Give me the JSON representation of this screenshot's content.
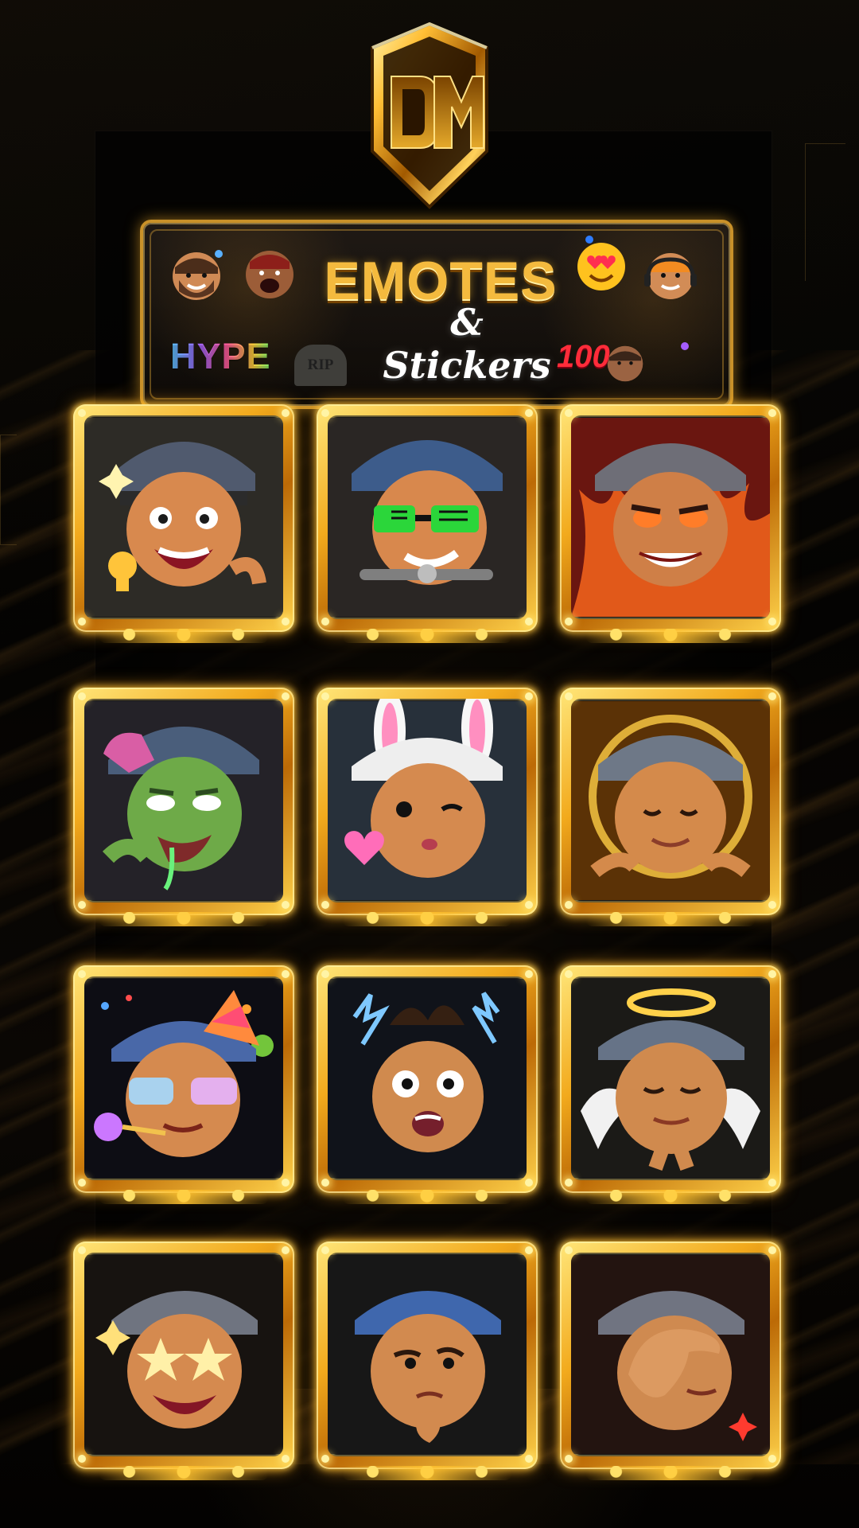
{
  "brand": {
    "logo_text": "DM",
    "accent_gold": "#f0b43a",
    "accent_orange": "#ff9c2a",
    "dark_bg": "#050403"
  },
  "banner": {
    "title": "EMOTES",
    "subtitle": "& Stickers",
    "hype": "HYPE",
    "rip": "RIP",
    "hundred": "100"
  },
  "emotes": [
    {
      "icon": "trophy-emote-icon",
      "bg": "#2d2b26"
    },
    {
      "icon": "driving-sunglasses-emote-icon",
      "bg": "#2a2624"
    },
    {
      "icon": "rage-emote-icon",
      "bg": "#6a1610"
    },
    {
      "icon": "zombie-emote-icon",
      "bg": "#242228"
    },
    {
      "icon": "bunny-kiss-emote-icon",
      "bg": "#27303a"
    },
    {
      "icon": "meditate-emote-icon",
      "bg": "#5b3206"
    },
    {
      "icon": "party-emote-icon",
      "bg": "#0d0d14"
    },
    {
      "icon": "shock-emote-icon",
      "bg": "#10131a"
    },
    {
      "icon": "angel-emote-icon",
      "bg": "#1b1a17"
    },
    {
      "icon": "star-eyes-emote-icon",
      "bg": "#171310"
    },
    {
      "icon": "thinking-emote-icon",
      "bg": "#171717"
    },
    {
      "icon": "facepalm-emote-icon",
      "bg": "#231410"
    }
  ]
}
